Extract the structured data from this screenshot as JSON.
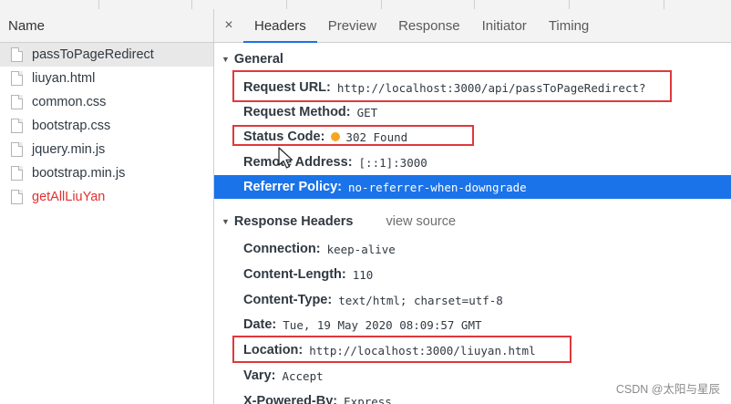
{
  "left_pane": {
    "header": "Name",
    "files": [
      {
        "name": "passToPageRedirect",
        "selected": true,
        "error": false
      },
      {
        "name": "liuyan.html",
        "selected": false,
        "error": false
      },
      {
        "name": "common.css",
        "selected": false,
        "error": false
      },
      {
        "name": "bootstrap.css",
        "selected": false,
        "error": false
      },
      {
        "name": "jquery.min.js",
        "selected": false,
        "error": false
      },
      {
        "name": "bootstrap.min.js",
        "selected": false,
        "error": false
      },
      {
        "name": "getAllLiuYan",
        "selected": false,
        "error": true
      }
    ]
  },
  "tabs": {
    "close": "×",
    "items": [
      "Headers",
      "Preview",
      "Response",
      "Initiator",
      "Timing"
    ],
    "active": "Headers"
  },
  "general": {
    "title": "General",
    "rows": [
      {
        "key": "Request URL:",
        "value": "http://localhost:3000/api/passToPageRedirect?"
      },
      {
        "key": "Request Method:",
        "value": "GET"
      },
      {
        "key": "Status Code:",
        "value": "302 Found"
      },
      {
        "key": "Remote Address:",
        "value": "[::1]:3000"
      },
      {
        "key": "Referrer Policy:",
        "value": "no-referrer-when-downgrade"
      }
    ]
  },
  "response_headers": {
    "title": "Response Headers",
    "view_source": "view source",
    "rows": [
      {
        "key": "Connection:",
        "value": "keep-alive"
      },
      {
        "key": "Content-Length:",
        "value": "110"
      },
      {
        "key": "Content-Type:",
        "value": "text/html; charset=utf-8"
      },
      {
        "key": "Date:",
        "value": "Tue, 19 May 2020 08:09:57 GMT"
      },
      {
        "key": "Location:",
        "value": "http://localhost:3000/liuyan.html"
      },
      {
        "key": "Vary:",
        "value": "Accept"
      },
      {
        "key": "X-Powered-By:",
        "value": "Express"
      }
    ]
  },
  "watermark": "CSDN @太阳与星辰",
  "colors": {
    "accent": "#1a73e8",
    "highlight_box": "#e0383c",
    "error_text": "#e13030",
    "status_dot": "#f5a623"
  }
}
